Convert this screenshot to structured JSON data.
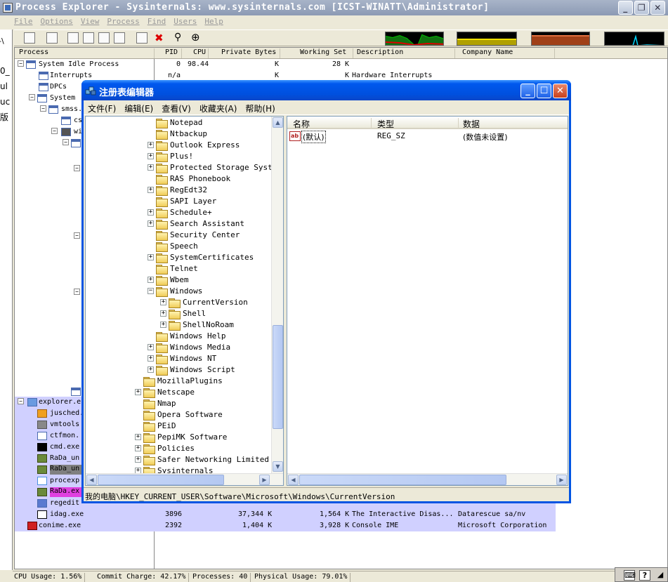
{
  "process_explorer": {
    "title": "Process Explorer - Sysinternals: www.sysinternals.com [ICST-WINATT\\Administrator]",
    "menu": [
      "File",
      "Options",
      "View",
      "Process",
      "Find",
      "Users",
      "Help"
    ],
    "left_edge_chars": [
      "0_",
      "ul",
      "uc",
      "版"
    ],
    "columns": [
      "Process",
      "PID",
      "CPU",
      "Private Bytes",
      "Working Set",
      "Description",
      "Company Name"
    ],
    "rows": [
      {
        "name": "System Idle Process",
        "pid": "0",
        "cpu": "98.44",
        "private": "K",
        "working": "28 K",
        "description": "",
        "company": ""
      },
      {
        "name": "Interrupts",
        "pid": "n/a",
        "cpu": "",
        "private": "K",
        "working": "K",
        "description": "Hardware Interrupts",
        "company": ""
      },
      {
        "name": "DPCs",
        "pid": "",
        "cpu": "",
        "private": "",
        "working": "",
        "description": "",
        "company": ""
      },
      {
        "name": "System",
        "pid": "",
        "cpu": "",
        "private": "",
        "working": "",
        "description": "",
        "company": ""
      },
      {
        "name": "smss.",
        "pid": "",
        "cpu": "",
        "private": "",
        "working": "",
        "description": "",
        "company": ""
      },
      {
        "name": "cs",
        "pid": "",
        "cpu": "",
        "private": "",
        "working": "",
        "description": "",
        "company": ""
      },
      {
        "name": "wi",
        "pid": "",
        "cpu": "",
        "private": "",
        "working": "",
        "description": "",
        "company": ""
      }
    ],
    "lower_rows": [
      {
        "name": "explorer.e",
        "pid": "",
        "private": "",
        "working": "",
        "description": "",
        "company": ""
      },
      {
        "name": "jusched.",
        "pid": "",
        "private": "",
        "working": "",
        "description": "",
        "company": ""
      },
      {
        "name": "vmtools",
        "pid": "",
        "private": "",
        "working": "",
        "description": "",
        "company": ""
      },
      {
        "name": "ctfmon.",
        "pid": "",
        "private": "",
        "working": "",
        "description": "",
        "company": ""
      },
      {
        "name": "cmd.exe",
        "pid": "",
        "private": "",
        "working": "",
        "description": "",
        "company": ""
      },
      {
        "name": "RaDa_un",
        "pid": "",
        "private": "",
        "working": "",
        "description": "",
        "company": ""
      },
      {
        "name": "RaDa_un",
        "pid": "",
        "private": "",
        "working": "",
        "description": "",
        "company": ""
      },
      {
        "name": "procexp",
        "pid": "",
        "private": "",
        "working": "",
        "description": "",
        "company": ""
      },
      {
        "name": "RaDa.ex",
        "pid": "",
        "private": "",
        "working": "",
        "description": "",
        "company": ""
      },
      {
        "name": "regedit",
        "pid": "",
        "private": "",
        "working": "",
        "description": "",
        "company": ""
      },
      {
        "name": "idag.exe",
        "pid": "3896",
        "private": "37,344 K",
        "working": "1,564 K",
        "description": "The Interactive Disas...",
        "company": "Datarescue sa/nv"
      },
      {
        "name": "conime.exe",
        "pid": "2392",
        "private": "1,404 K",
        "working": "3,928 K",
        "description": "Console IME",
        "company": "Microsoft Corporation"
      }
    ],
    "status": {
      "cpu": "CPU Usage: 1.56%",
      "commit": "Commit Charge: 42.17%",
      "processes": "Processes: 40",
      "physical": "Physical Usage: 79.01%"
    }
  },
  "regedit": {
    "title": "注册表编辑器",
    "menu": [
      "文件(F)",
      "编辑(E)",
      "查看(V)",
      "收藏夹(A)",
      "帮助(H)"
    ],
    "tree": [
      {
        "label": "Notepad",
        "expandable": false,
        "depth": 1
      },
      {
        "label": "Ntbackup",
        "expandable": false,
        "depth": 1
      },
      {
        "label": "Outlook Express",
        "expandable": true,
        "depth": 1
      },
      {
        "label": "Plus!",
        "expandable": true,
        "depth": 1
      },
      {
        "label": "Protected Storage System",
        "expandable": true,
        "depth": 1
      },
      {
        "label": "RAS Phonebook",
        "expandable": false,
        "depth": 1
      },
      {
        "label": "RegEdt32",
        "expandable": true,
        "depth": 1
      },
      {
        "label": "SAPI Layer",
        "expandable": false,
        "depth": 1
      },
      {
        "label": "Schedule+",
        "expandable": true,
        "depth": 1
      },
      {
        "label": "Search Assistant",
        "expandable": true,
        "depth": 1
      },
      {
        "label": "Security Center",
        "expandable": false,
        "depth": 1
      },
      {
        "label": "Speech",
        "expandable": false,
        "depth": 1
      },
      {
        "label": "SystemCertificates",
        "expandable": true,
        "depth": 1
      },
      {
        "label": "Telnet",
        "expandable": false,
        "depth": 1
      },
      {
        "label": "Wbem",
        "expandable": true,
        "depth": 1
      },
      {
        "label": "Windows",
        "expandable": true,
        "expanded": true,
        "depth": 1
      },
      {
        "label": "CurrentVersion",
        "expandable": true,
        "depth": 2,
        "open": true
      },
      {
        "label": "Shell",
        "expandable": true,
        "depth": 2
      },
      {
        "label": "ShellNoRoam",
        "expandable": true,
        "depth": 2
      },
      {
        "label": "Windows Help",
        "expandable": false,
        "depth": 1
      },
      {
        "label": "Windows Media",
        "expandable": true,
        "depth": 1
      },
      {
        "label": "Windows NT",
        "expandable": true,
        "depth": 1
      },
      {
        "label": "Windows Script",
        "expandable": true,
        "depth": 1
      },
      {
        "label": "MozillaPlugins",
        "expandable": false,
        "depth": 0
      },
      {
        "label": "Netscape",
        "expandable": true,
        "depth": 0
      },
      {
        "label": "Nmap",
        "expandable": false,
        "depth": 0
      },
      {
        "label": "Opera Software",
        "expandable": false,
        "depth": 0
      },
      {
        "label": "PEiD",
        "expandable": false,
        "depth": 0
      },
      {
        "label": "PepiMK Software",
        "expandable": true,
        "depth": 0
      },
      {
        "label": "Policies",
        "expandable": true,
        "depth": 0
      },
      {
        "label": "Safer Networking Limited",
        "expandable": true,
        "depth": 0
      },
      {
        "label": "Sysinternals",
        "expandable": true,
        "depth": 0
      }
    ],
    "list_columns": [
      "名称",
      "类型",
      "数据"
    ],
    "list_rows": [
      {
        "name": "(默认)",
        "type": "REG_SZ",
        "data": "(数值未设置)"
      }
    ],
    "status_path": "我的电脑\\HKEY_CURRENT_USER\\Software\\Microsoft\\Windows\\CurrentVersion"
  }
}
